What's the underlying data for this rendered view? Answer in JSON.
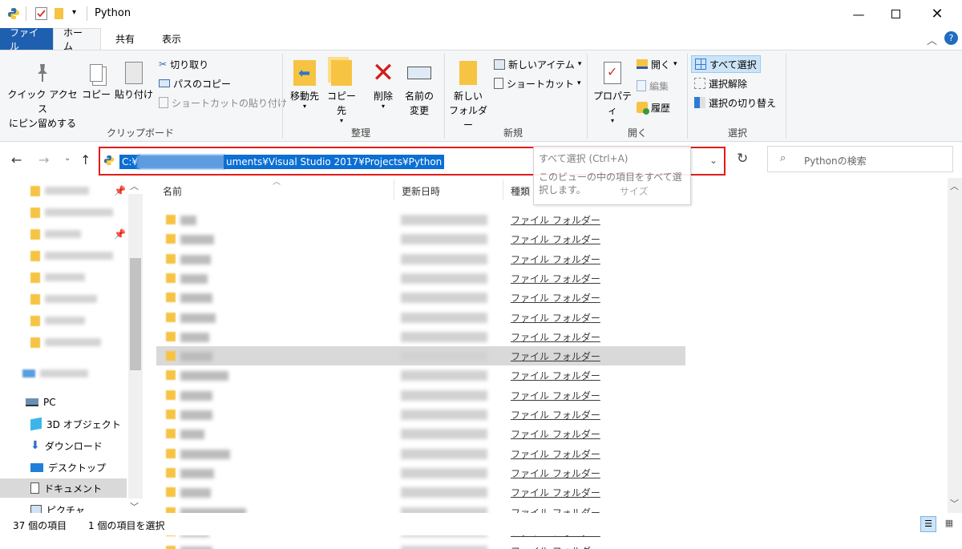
{
  "window": {
    "title": "Python"
  },
  "tabs": [
    "ファイル",
    "ホーム",
    "共有",
    "表示"
  ],
  "ribbon": {
    "clipboard": {
      "pin": "クイック アクセス",
      "pin2": "にピン留めする",
      "copy": "コピー",
      "paste": "貼り付け",
      "cut": "切り取り",
      "copy_path": "パスのコピー",
      "paste_shortcut": "ショートカットの貼り付け",
      "label": "クリップボード"
    },
    "organize": {
      "move": "移動先",
      "copy_to": "コピー先",
      "delete": "削除",
      "rename": "名前の",
      "rename2": "変更",
      "label": "整理"
    },
    "new": {
      "new_folder": "新しい",
      "new_folder2": "フォルダー",
      "new_item": "新しいアイテム",
      "shortcut": "ショートカット",
      "label": "新規"
    },
    "open": {
      "properties": "プロパティ",
      "open": "開く",
      "edit": "編集",
      "history": "履歴",
      "label": "開く"
    },
    "select": {
      "select_all": "すべて選択",
      "select_none": "選択解除",
      "invert": "選択の切り替え",
      "label": "選択"
    }
  },
  "address": {
    "visible_start": "C:¥",
    "visible_end": "uments¥Visual Studio 2017¥Projects¥Python"
  },
  "tooltip": {
    "title": "すべて選択 (Ctrl+A)",
    "body1": "このビューの中の項目をすべて選",
    "body2": "択します。"
  },
  "search": {
    "placeholder": "Pythonの検索"
  },
  "columns": {
    "name": "名前",
    "date": "更新日時",
    "type": "種類",
    "size": "サイズ"
  },
  "nav": {
    "pc": "PC",
    "items": [
      "3D オブジェクト",
      "ダウンロード",
      "デスクトップ",
      "ドキュメント",
      "ピクチャ"
    ]
  },
  "file_type": "ファイル フォルダー",
  "status": {
    "count": "37 個の項目",
    "selected": "1 個の項目を選択"
  }
}
